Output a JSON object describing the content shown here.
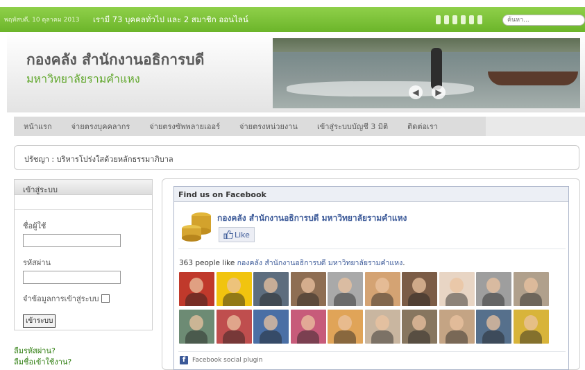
{
  "topbar": {
    "date": "พฤหัสบดี, 10 ตุลาคม 2013",
    "online": "เรามี 73 บุคคลทั่วไป และ 2 สมาชิก ออนไลน์",
    "search_placeholder": "ค้นหา...",
    "bar_color": "#7cc23a"
  },
  "header": {
    "title": "กองคลัง สำนักงานอธิการบดี",
    "subtitle": "มหาวิทยาลัยรามคำแหง",
    "banner_prev_icon": "arrow-left-icon",
    "banner_next_icon": "arrow-right-icon"
  },
  "nav": {
    "items": [
      "หน้าแรก",
      "จ่ายตรงบุคคลากร",
      "จ่ายตรงซัพพลายเออร์",
      "จ่ายตรงหน่วยงาน",
      "เข้าสู่ระบบบัญชี 3 มิติ",
      "ติดต่อเรา"
    ]
  },
  "motto": "ปรัชญา : บริหารโปร่งใสด้วยหลักธรรมาภิบาล",
  "login": {
    "heading": "เข้าสู่ระบบ",
    "username_label": "ชื่อผู้ใช้",
    "password_label": "รหัสผ่าน",
    "remember_label": "จำข้อมูลการเข้าสู่ระบบ",
    "submit_label": "เข้าระบบ",
    "forgot_password": "ลืมรหัสผ่าน?",
    "forgot_username": "ลืมชื่อเข้าใช้งาน?"
  },
  "facebook": {
    "heading": "Find us on Facebook",
    "page_name": "กองคลัง สำนักงานอธิการบดี มหาวิทยาลัยรามคำแหง",
    "like_label": "Like",
    "count_prefix": "363 people like ",
    "count_link": "กองคลัง สำนักงานอธิการบดี มหาวิทยาลัยรามคำแหง",
    "count_suffix": ".",
    "plugin_label": "Facebook social plugin",
    "brand_color": "#3b5998",
    "face_colors": [
      "#c0392b",
      "#f1c40f",
      "#5d6d7e",
      "#8e6e53",
      "#a9a9a9",
      "#d4a373",
      "#7b5c46",
      "#e8d5c4",
      "#9e9e9e",
      "#b0a08c",
      "#6d8b74",
      "#bf4e4e",
      "#4a6fa5",
      "#c75b7a",
      "#e0a458",
      "#c9b6a0",
      "#87765f",
      "#c4a484",
      "#56708c",
      "#d8b43a"
    ]
  }
}
